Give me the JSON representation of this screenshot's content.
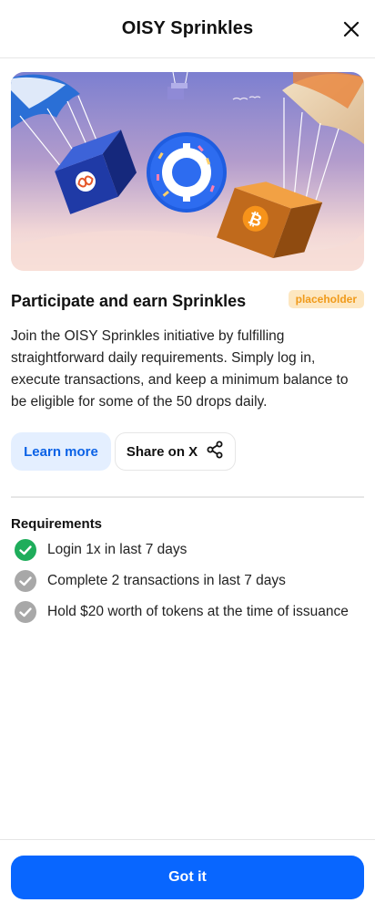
{
  "dialog": {
    "title": "OISY Sprinkles"
  },
  "hero": {
    "icons": [
      "icp-box-icon",
      "oisy-coin-icon",
      "bitcoin-box-icon"
    ]
  },
  "content": {
    "heading": "Participate and earn Sprinkles",
    "badge": "placeholder",
    "description": "Join the OISY Sprinkles initiative by fulfilling straightforward daily requirements. Simply log in, execute transactions, and keep a minimum balance to be eligible for some of the 50 drops daily."
  },
  "actions": {
    "learn_more": "Learn more",
    "share": "Share on X"
  },
  "requirements": {
    "title": "Requirements",
    "items": [
      {
        "label": "Login 1x in last 7 days",
        "done": true
      },
      {
        "label": "Complete 2 transactions in last 7 days",
        "done": false
      },
      {
        "label": "Hold $20 worth of tokens at the time of issuance",
        "done": false
      }
    ]
  },
  "footer": {
    "confirm": "Got it"
  },
  "colors": {
    "primary": "#0866ff",
    "success": "#1fad5b",
    "pending": "#a8a8a8",
    "badge_bg": "#fde7c1",
    "badge_text": "#f09a1a"
  }
}
